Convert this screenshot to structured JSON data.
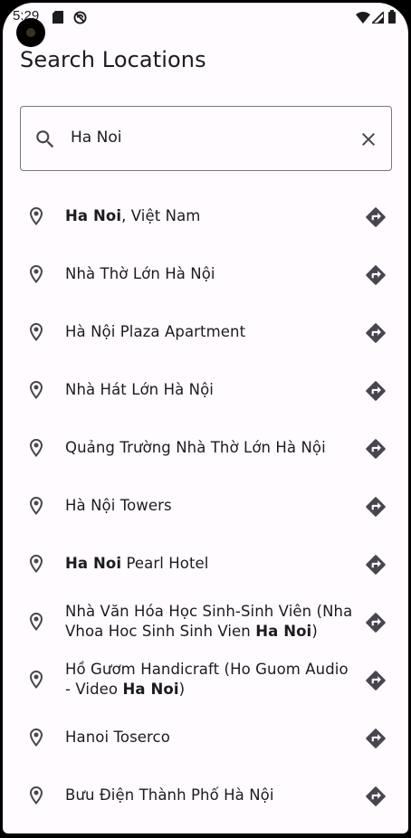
{
  "status_bar": {
    "time": "5:29",
    "icons": [
      "sd-card-icon",
      "no-sync-icon",
      "wifi-icon",
      "cell-signal-icon",
      "battery-icon"
    ]
  },
  "page": {
    "title": "Search Locations"
  },
  "search": {
    "value": "Ha Noi",
    "icon": "search-icon",
    "clear_icon": "close-icon"
  },
  "results": [
    {
      "bold": "Ha Noi",
      "rest": ", Việt Nam"
    },
    {
      "bold": "",
      "rest": "Nhà Thờ Lớn Hà Nội"
    },
    {
      "bold": "",
      "rest": "Hà Nội Plaza Apartment"
    },
    {
      "bold": "",
      "rest": "Nhà Hát Lớn Hà Nội"
    },
    {
      "bold": "",
      "rest": "Quảng Trường Nhà Thờ Lớn Hà Nội"
    },
    {
      "bold": "",
      "rest": "Hà Nội Towers"
    },
    {
      "bold": "Ha Noi",
      "rest": " Pearl Hotel"
    },
    {
      "pre": "Nhà Văn Hóa Học Sinh-Sinh Viên (Nha Vhoa Hoc Sinh Sinh Vien ",
      "bold": "Ha Noi",
      "rest": ")"
    },
    {
      "pre": "Hồ Gươm Handicraft (Ho Guom Audio - Video ",
      "bold": "Ha Noi",
      "rest": ")"
    },
    {
      "bold": "",
      "rest": "Hanoi Toserco"
    },
    {
      "bold": "",
      "rest": "Bưu Điện Thành Phố Hà Nội"
    }
  ],
  "icons": {
    "result_leading": "location-pin-icon",
    "result_trailing": "directions-icon"
  },
  "colors": {
    "background": "#fffbfe",
    "text": "#1c1b1f",
    "icon": "#49454f",
    "outline": "#79747e"
  }
}
